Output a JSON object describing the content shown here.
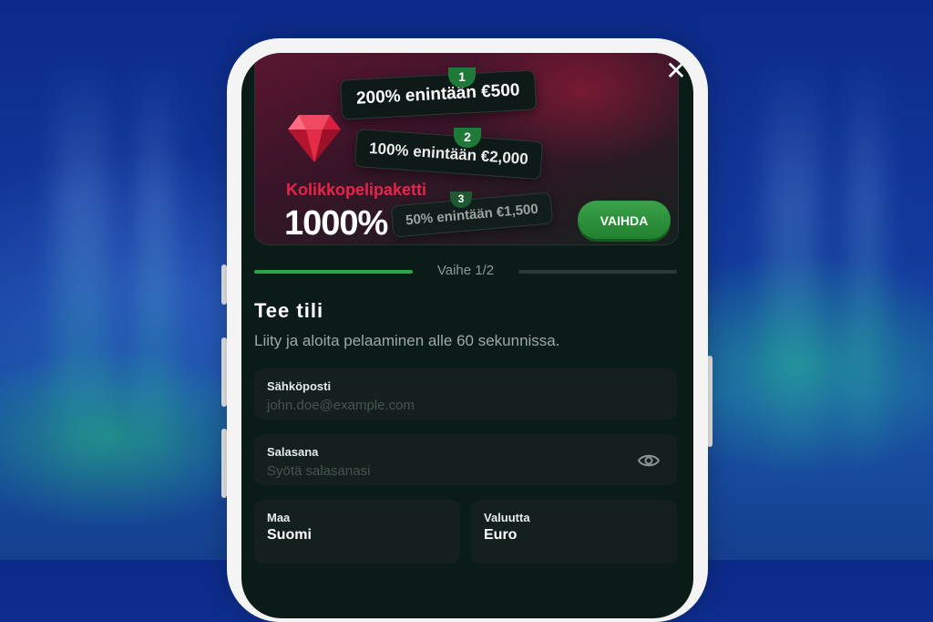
{
  "background": {
    "accent": "#1f7a3a",
    "brand_red": "#e8244a"
  },
  "header": {
    "close_icon": "close-icon"
  },
  "offer": {
    "tiers": [
      {
        "number": "1",
        "label": "200% enintään €500"
      },
      {
        "number": "2",
        "label": "100% enintään €2,000"
      },
      {
        "number": "3",
        "label": "50% enintään €1,500"
      }
    ],
    "icon": "ruby-gem-icon",
    "package_name": "Kolikkopelipaketti",
    "package_percent": "1000%",
    "change_button": "VAIHDA"
  },
  "progress": {
    "step_label": "Vaihe 1/2",
    "completed_fraction": 0.5
  },
  "form": {
    "title": "Tee tili",
    "subtitle": "Liity ja aloita pelaaminen alle 60 sekunnissa.",
    "email": {
      "label": "Sähköposti",
      "placeholder": "john.doe@example.com"
    },
    "password": {
      "label": "Salasana",
      "placeholder": "Syötä salasanasi",
      "toggle_icon": "eye-icon"
    },
    "country": {
      "label": "Maa",
      "value": "Suomi"
    },
    "currency": {
      "label": "Valuutta",
      "value": "Euro"
    }
  }
}
